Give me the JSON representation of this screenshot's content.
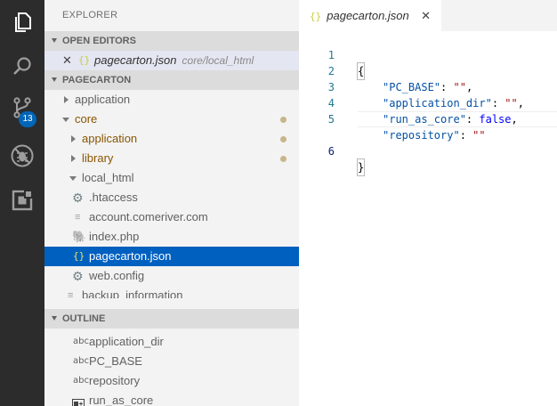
{
  "activity_bar": {
    "source_control_badge": "13"
  },
  "sidebar": {
    "title": "EXPLORER",
    "open_editors": {
      "header": "OPEN EDITORS",
      "items": [
        {
          "name": "pagecarton.json",
          "description": "core/local_html",
          "icon": "json-braces-icon"
        }
      ]
    },
    "project": {
      "header": "PAGECARTON",
      "tree": [
        {
          "label": "application",
          "level": 0,
          "folder": "collapsed",
          "modified": false
        },
        {
          "label": "core",
          "level": 0,
          "folder": "expanded",
          "modified": true
        },
        {
          "label": "application",
          "level": 1,
          "folder": "collapsed",
          "modified": true
        },
        {
          "label": "library",
          "level": 1,
          "folder": "collapsed",
          "modified": true
        },
        {
          "label": "local_html",
          "level": 1,
          "folder": "expanded",
          "modified": false
        },
        {
          "label": ".htaccess",
          "level": 2,
          "icon": "gear-icon"
        },
        {
          "label": "account.comeriver.com",
          "level": 2,
          "icon": "file-lines-icon"
        },
        {
          "label": "index.php",
          "level": 2,
          "icon": "php-elephant-icon"
        },
        {
          "label": "pagecarton.json",
          "level": 2,
          "icon": "json-braces-icon",
          "selected": true
        },
        {
          "label": "web.config",
          "level": 2,
          "icon": "gear-icon"
        },
        {
          "label": "backup_information",
          "level": 2,
          "icon": "file-lines-icon"
        }
      ]
    },
    "outline": {
      "header": "OUTLINE",
      "items": [
        {
          "label": "application_dir",
          "icon": "abc-string-icon"
        },
        {
          "label": "PC_BASE",
          "icon": "abc-string-icon"
        },
        {
          "label": "repository",
          "icon": "abc-string-icon"
        },
        {
          "label": "run_as_core",
          "icon": "boolean-icon"
        }
      ]
    }
  },
  "editor": {
    "tab": {
      "label": "pagecarton.json",
      "icon": "json-braces-icon"
    },
    "lines": [
      {
        "num": "1",
        "open": "{"
      },
      {
        "num": "2",
        "key": "\"PC_BASE\"",
        "sep": ": ",
        "value": "\"\"",
        "value_type": "string",
        "end": ","
      },
      {
        "num": "3",
        "key": "\"application_dir\"",
        "sep": ": ",
        "value": "\"\"",
        "value_type": "string",
        "end": ","
      },
      {
        "num": "4",
        "key": "\"run_as_core\"",
        "sep": ": ",
        "value": "false",
        "value_type": "boolean",
        "end": ","
      },
      {
        "num": "5",
        "key": "\"repository\"",
        "sep": ": ",
        "value": "\"\"",
        "value_type": "string",
        "end": ""
      },
      {
        "num": "6",
        "close": "}"
      }
    ],
    "active_line": "6"
  },
  "colors": {
    "activity_bar": "#2c2c2c",
    "sidebar": "#f3f3f3",
    "selection": "#0060c0",
    "badge": "#0066b8",
    "json_key": "#0451a5",
    "json_string": "#a31515",
    "json_boolean": "#0000ff"
  }
}
